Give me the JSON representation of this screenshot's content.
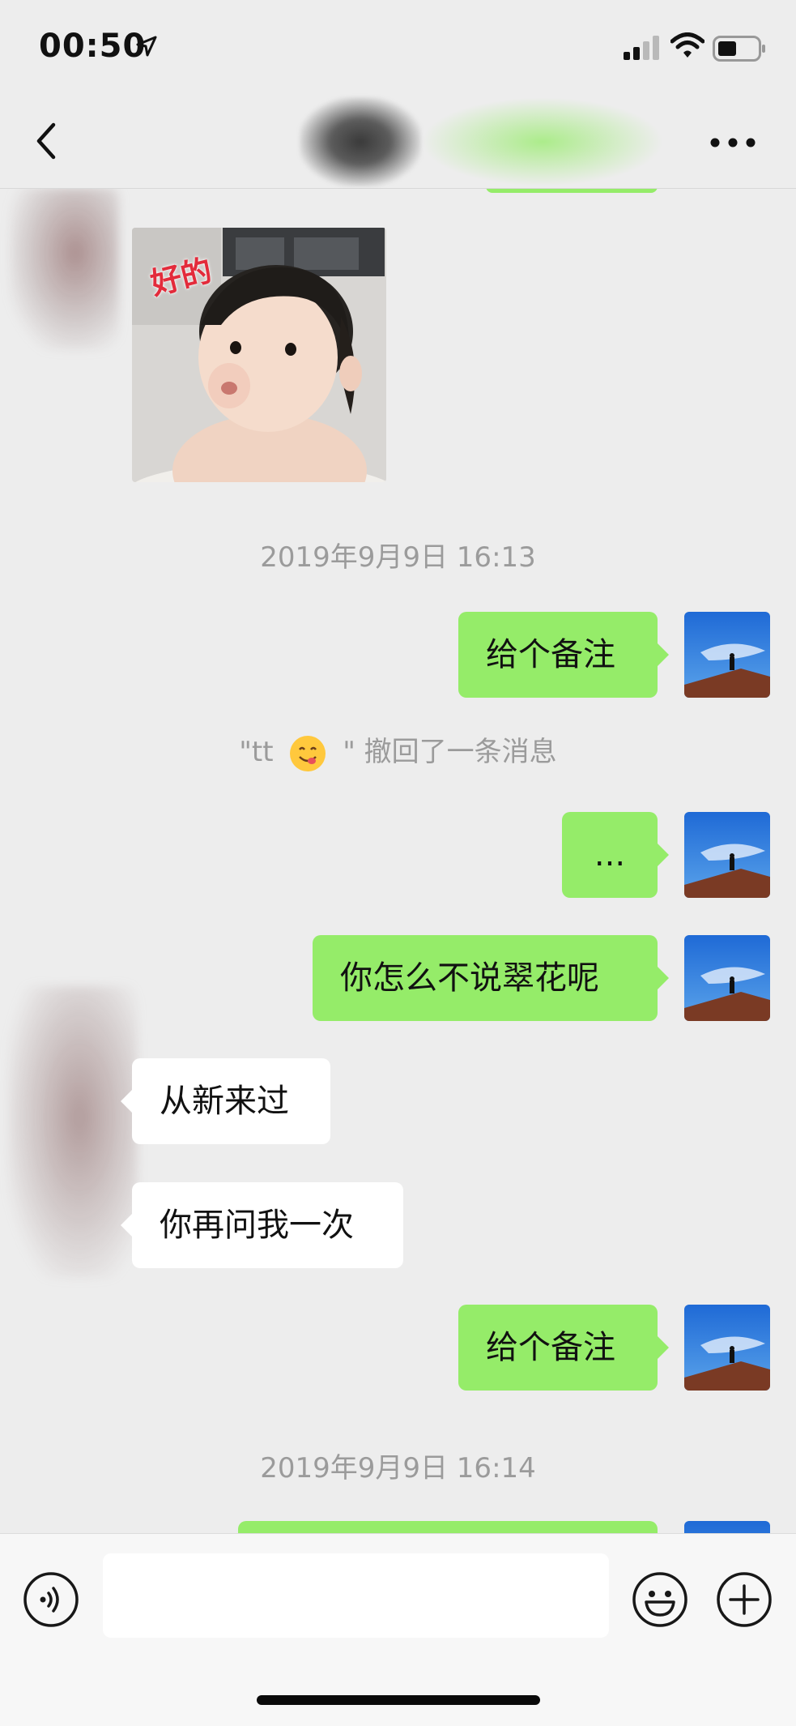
{
  "status_bar": {
    "time": "00:50",
    "icons": [
      "location-arrow-icon",
      "cellular-signal-icon",
      "wifi-icon",
      "battery-icon"
    ]
  },
  "nav": {
    "back_icon": "chevron-left-icon",
    "more_icon": "ellipsis-icon"
  },
  "messages": {
    "sticker": {
      "caption": "好的"
    },
    "timestamp_1": "2019年9月9日 16:13",
    "m1": "给个备注",
    "recall_prefix": "\"tt",
    "recall_suffix": "\" 撤回了一条消息",
    "m2": "...",
    "m3": "你怎么不说翠花呢",
    "r1": "从新来过",
    "r2": "你再问我一次",
    "m4": "给个备注",
    "timestamp_2": "2019年9月9日 16:14"
  },
  "input_bar": {
    "text_value": "",
    "voice_icon": "voice-input-icon",
    "emoji_icon": "emoji-icon",
    "plus_icon": "plus-circle-icon"
  },
  "colors": {
    "background": "#ededed",
    "my_bubble": "#95ec69",
    "their_bubble": "#ffffff",
    "timestamp_text": "#9b9b9b"
  }
}
